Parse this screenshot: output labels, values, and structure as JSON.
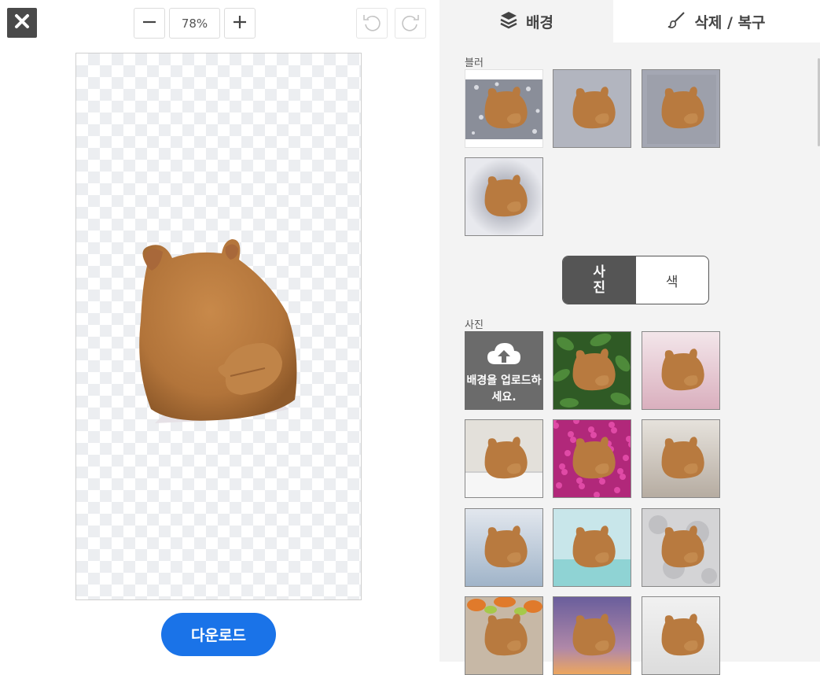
{
  "toolbar": {
    "zoom_value": "78%",
    "icons": {
      "close": "close-icon",
      "zoom_out": "minus-icon",
      "zoom_in": "plus-icon",
      "undo": "undo-icon",
      "redo": "redo-icon"
    }
  },
  "download": {
    "label": "다운로드",
    "color": "#1a73e8"
  },
  "tabs": [
    {
      "label": "배경",
      "icon": "layers-icon",
      "active": true
    },
    {
      "label": "삭제 / 복구",
      "icon": "brush-icon",
      "active": false
    }
  ],
  "blur": {
    "label": "블러",
    "items": [
      "blur-none",
      "blur-light",
      "blur-medium",
      "blur-strong"
    ],
    "selected_index": 0
  },
  "mode_toggle": {
    "options": [
      "사진",
      "색"
    ],
    "selected": "사진"
  },
  "photos": {
    "label": "사진",
    "upload_label": "배경을 업로드하세요.",
    "upload_icon": "cloud-upload-icon",
    "backgrounds": [
      "green-leaves",
      "pink-gradient",
      "white-table",
      "pink-flowers",
      "beige-wall",
      "blue-gray",
      "teal-studio",
      "marble",
      "autumn-wood",
      "purple-sunset",
      "light-gray"
    ]
  }
}
